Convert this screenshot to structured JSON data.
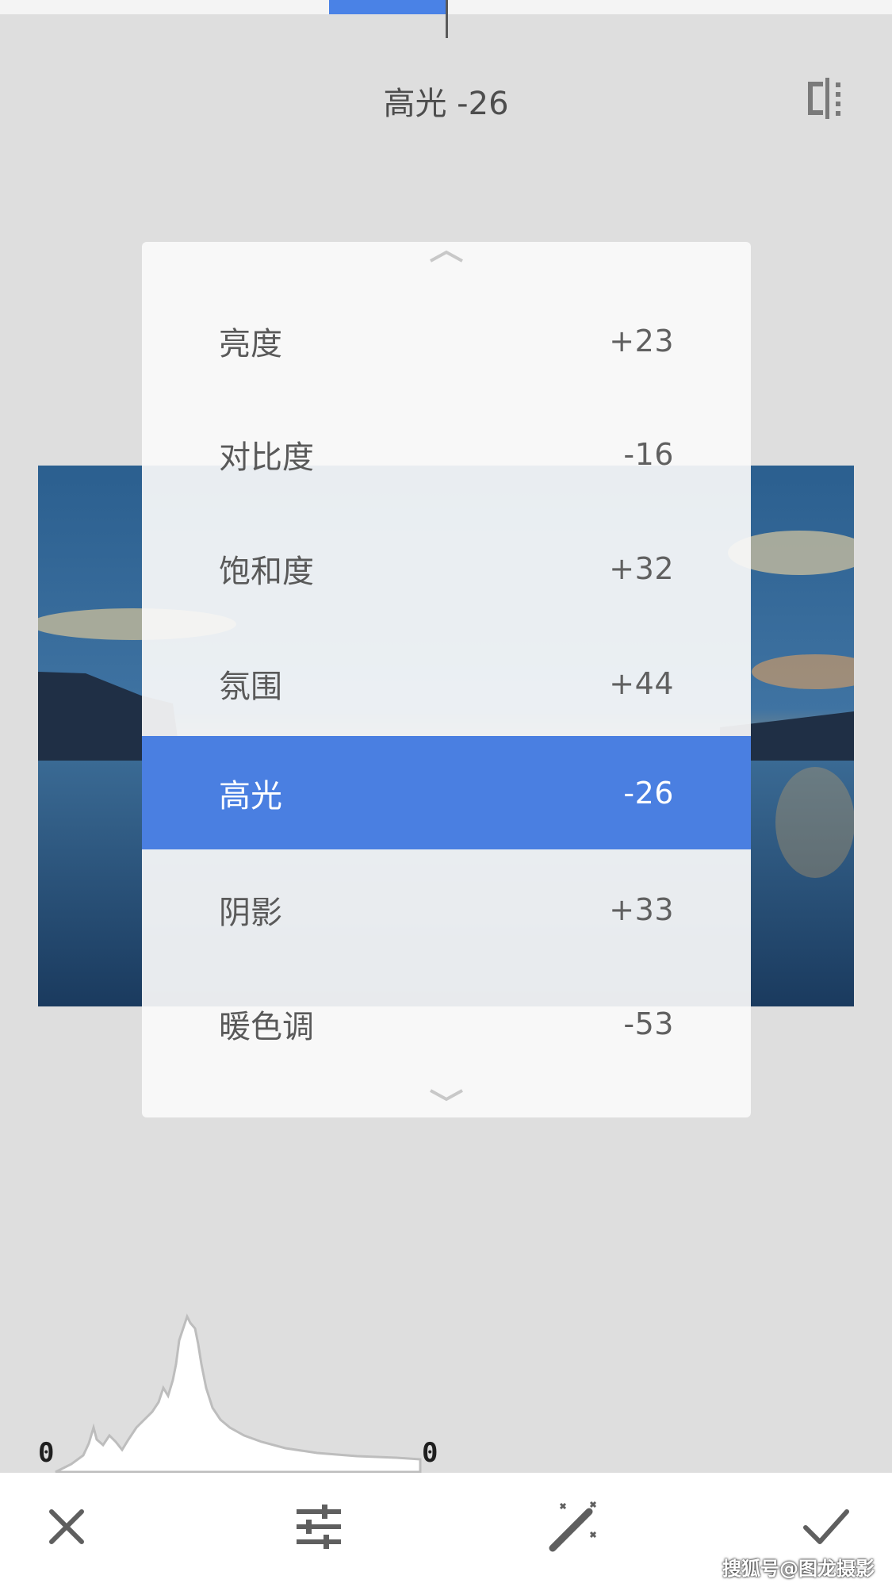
{
  "header": {
    "title": "高光 -26",
    "compare_icon": "split-compare-icon"
  },
  "top_slider": {
    "value": -26
  },
  "menu": {
    "items": [
      {
        "label": "亮度",
        "value": "+23",
        "selected": false
      },
      {
        "label": "对比度",
        "value": "-16",
        "selected": false
      },
      {
        "label": "饱和度",
        "value": "+32",
        "selected": false
      },
      {
        "label": "氛围",
        "value": "+44",
        "selected": false
      },
      {
        "label": "高光",
        "value": "-26",
        "selected": true
      },
      {
        "label": "阴影",
        "value": "+33",
        "selected": false
      },
      {
        "label": "暖色调",
        "value": "-53",
        "selected": false
      }
    ],
    "scroll_up_icon": "chevron-up-icon",
    "scroll_down_icon": "chevron-down-icon"
  },
  "histogram": {
    "left_label": "0",
    "right_label": "0"
  },
  "toolbar": {
    "cancel_icon": "close-icon",
    "tune_icon": "sliders-icon",
    "auto_icon": "magic-wand-icon",
    "apply_icon": "check-icon"
  },
  "watermark": "搜狐号@图龙摄影",
  "colors": {
    "accent": "#4a7fe1",
    "background": "#dedede",
    "menu_bg": "#fafafa",
    "text": "#595959"
  }
}
